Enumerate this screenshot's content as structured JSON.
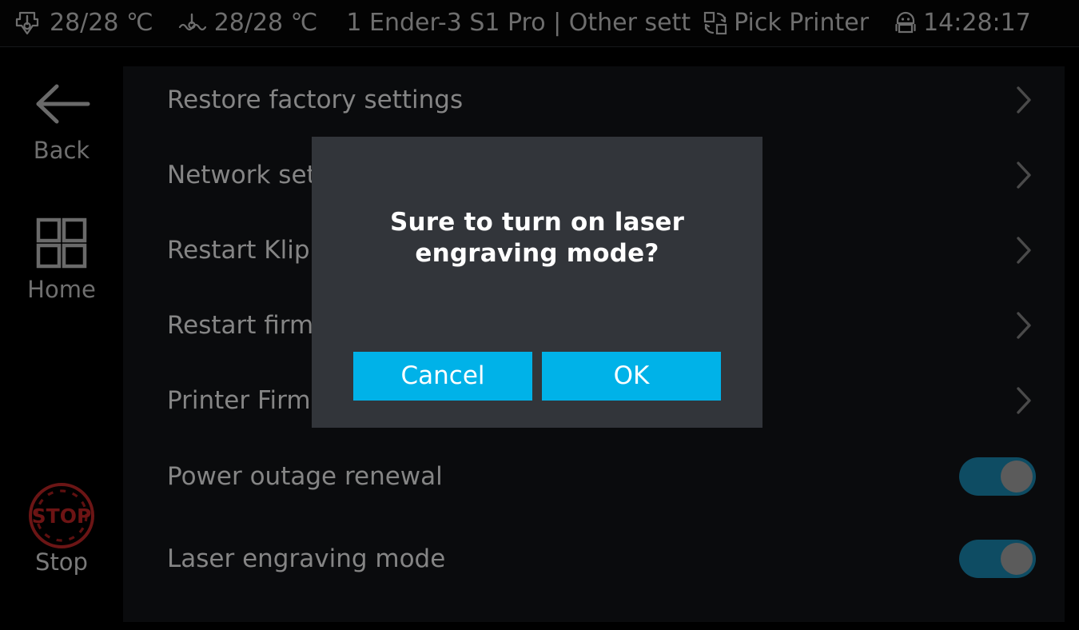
{
  "topbar": {
    "nozzle_icon": "nozzle-temperature-icon",
    "nozzle_temp": "28/28 ℃",
    "bed_icon": "heated-bed-temperature-icon",
    "bed_temp": "28/28 ℃",
    "printer_title": "1 Ender-3 S1 Pro | Other sett",
    "pick_printer_icon": "swap-printers-icon",
    "pick_printer_label": "Pick Printer",
    "robot_icon": "printer-robot-icon",
    "clock": "14:28:17",
    "text_color": "#6e6e6e",
    "background": "#030303"
  },
  "sidebar": {
    "items": [
      {
        "id": "back",
        "label": "Back",
        "icon": "arrow-left-icon"
      },
      {
        "id": "home",
        "label": "Home",
        "icon": "grid-home-icon"
      },
      {
        "id": "stop",
        "label": "Stop",
        "icon": "stop-icon",
        "icon_text": "STOP",
        "icon_color": "#5e0d0d"
      }
    ]
  },
  "settings_list": {
    "rows": [
      {
        "label": "Restore factory settings",
        "control": "chevron"
      },
      {
        "label": "Network set",
        "control": "chevron"
      },
      {
        "label": "Restart Klipp",
        "control": "chevron"
      },
      {
        "label": "Restart firm",
        "control": "chevron"
      },
      {
        "label": "Printer Firm",
        "control": "chevron"
      },
      {
        "label": "Power outage renewal",
        "control": "toggle",
        "toggle_on": true
      },
      {
        "label": "Laser engraving mode",
        "control": "toggle",
        "toggle_on": true
      }
    ]
  },
  "dialog": {
    "message": "Sure to turn on laser engraving mode?",
    "cancel_label": "Cancel",
    "ok_label": "OK",
    "background": "#32353a",
    "button_color": "#00b2e8"
  }
}
